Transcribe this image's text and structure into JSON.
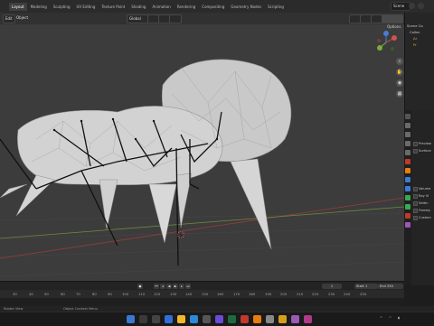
{
  "app": {
    "name": "Blender"
  },
  "menu": {
    "items": []
  },
  "workspace_tabs": [
    {
      "label": "Layout",
      "active": true
    },
    {
      "label": "Modeling"
    },
    {
      "label": "Sculpting"
    },
    {
      "label": "UV Editing"
    },
    {
      "label": "Texture Paint"
    },
    {
      "label": "Shading"
    },
    {
      "label": "Animation"
    },
    {
      "label": "Rendering"
    },
    {
      "label": "Compositing"
    },
    {
      "label": "Geometry Nodes"
    },
    {
      "label": "Scripting"
    }
  ],
  "scene": {
    "label": "Scene"
  },
  "viewport_header": {
    "mode": "Edit",
    "object_menu": "Object",
    "transform_orientation": "Global",
    "options_label": "Options"
  },
  "viewport": {
    "background": "#3c3c3c"
  },
  "outliner": {
    "rows": [
      "Scene Co",
      "Collec",
      "Ar",
      "Pr"
    ]
  },
  "properties": {
    "rows": [
      "Preview",
      "Surface",
      "Volume",
      "Ray Vi",
      "Settin",
      "Freesty",
      "Custom"
    ]
  },
  "timeline": {
    "ticks": [
      "30",
      "40",
      "50",
      "60",
      "70",
      "80",
      "90",
      "100",
      "110",
      "120",
      "130",
      "140",
      "150",
      "160",
      "170",
      "180",
      "190",
      "200",
      "210",
      "220",
      "230",
      "240",
      "250"
    ],
    "current_frame": "1",
    "start_label": "Start",
    "start_value": "1",
    "end_label": "End",
    "end_value": "250"
  },
  "status_bar": {
    "left": "Rotate View",
    "mid": "Object Context Menu"
  },
  "taskbar": {
    "colors": [
      "#0078d4",
      "#f3b72a",
      "#e74856",
      "#3aa757",
      "#ff8c00",
      "#9b59b6",
      "#00b7c3",
      "#5c5c5c"
    ]
  },
  "colors": {
    "accent": "#e87d0d",
    "grid": "#474747"
  }
}
